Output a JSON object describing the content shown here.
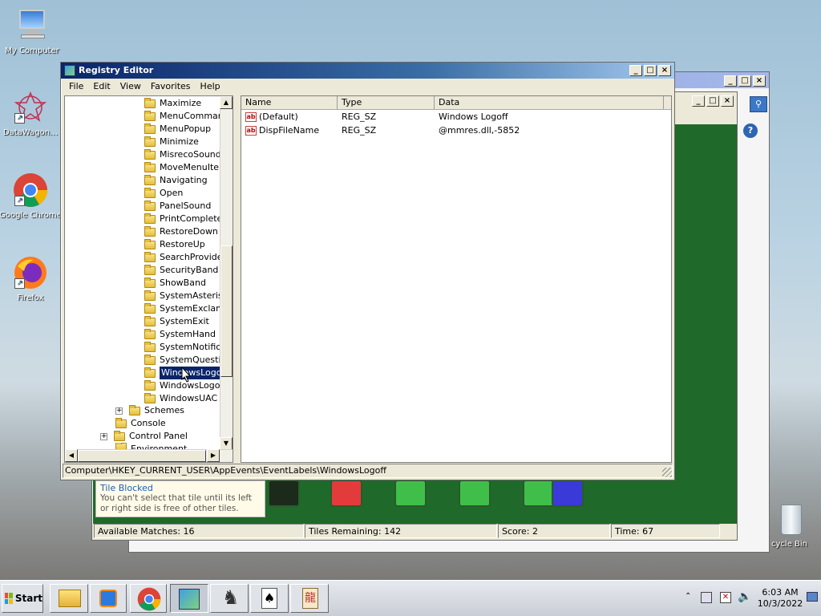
{
  "desktop": {
    "icons": [
      {
        "label": "My Computer",
        "icon": "computer-icon"
      },
      {
        "label": "DataWagon…",
        "icon": "datawagon-icon"
      },
      {
        "label": "Google Chrome",
        "icon": "chrome-icon"
      },
      {
        "label": "Firefox",
        "icon": "firefox-icon"
      }
    ],
    "recycle_label": "cycle Bin"
  },
  "regedit": {
    "title": "Registry Editor",
    "menu": [
      "File",
      "Edit",
      "View",
      "Favorites",
      "Help"
    ],
    "tree_items": [
      "Maximize",
      "MenuCommand",
      "MenuPopup",
      "Minimize",
      "MisrecoSound",
      "MoveMenuItem",
      "Navigating",
      "Open",
      "PanelSound",
      "PrintComplete",
      "RestoreDown",
      "RestoreUp",
      "SearchProviderD",
      "SecurityBand",
      "ShowBand",
      "SystemAsterisk",
      "SystemExclamat",
      "SystemExit",
      "SystemHand",
      "SystemNotificati",
      "SystemQuestion",
      "WindowsLogoff",
      "WindowsLogon",
      "WindowsUAC"
    ],
    "selected_item": "WindowsLogoff",
    "schemes_label": "Schemes",
    "console_label": "Console",
    "control_panel_label": "Control Panel",
    "environment_label": "Environment",
    "columns": [
      "Name",
      "Type",
      "Data"
    ],
    "values": [
      {
        "name": "(Default)",
        "type": "REG_SZ",
        "data": "Windows Logoff"
      },
      {
        "name": "DispFileName",
        "type": "REG_SZ",
        "data": "@mmres.dll,-5852"
      }
    ],
    "status_path": "Computer\\HKEY_CURRENT_USER\\AppEvents\\EventLabels\\WindowsLogoff"
  },
  "mahjong": {
    "tip_title": "Tile Blocked",
    "tip_text": "You can't select that tile until its left or right side is free of other tiles.",
    "status": {
      "matches": "Available Matches: 16",
      "tiles": "Tiles Remaining: 142",
      "score": "Score: 2",
      "time": "Time: 67"
    }
  },
  "taskbar": {
    "start_label": "Start",
    "time": "6:03 AM",
    "date": "10/3/2022"
  },
  "colors": {
    "title_active": "#0a246a",
    "felt": "#1f6a2a",
    "selection": "#0a246a"
  }
}
